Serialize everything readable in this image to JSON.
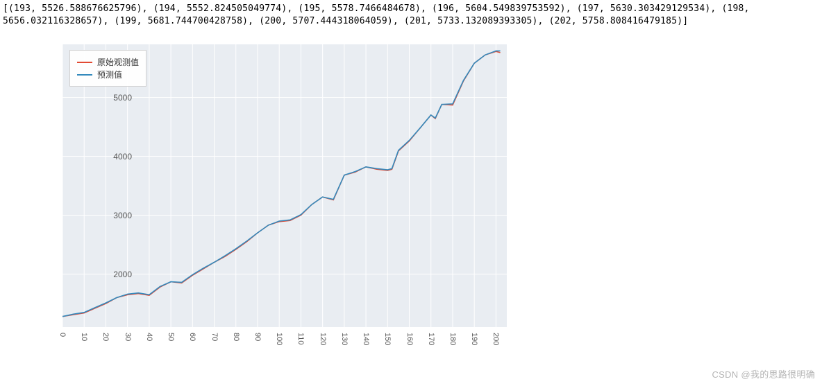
{
  "header_text": "[(193, 5526.588676625796), (194, 5552.824505049774), (195, 5578.7466484678), (196, 5604.549839753592), (197, 5630.303429129534), (198, 5656.032116328657), (199, 5681.744700428758), (200, 5707.444318064059), (201, 5733.132089393305), (202, 5758.808416479185)]",
  "watermark": "CSDN @我的思路很明确",
  "chart_data": {
    "type": "line",
    "title": "",
    "xlabel": "",
    "ylabel": "",
    "xlim": [
      0,
      205
    ],
    "ylim": [
      1100,
      5900
    ],
    "x_ticks": [
      0,
      10,
      20,
      30,
      40,
      50,
      60,
      70,
      80,
      90,
      100,
      110,
      120,
      130,
      140,
      150,
      160,
      170,
      180,
      190,
      200
    ],
    "y_ticks": [
      2000,
      3000,
      4000,
      5000
    ],
    "legend_position": "upper left",
    "grid": true,
    "series": [
      {
        "name": "原始观测值",
        "color": "#e24a33",
        "x": [
          0,
          5,
          10,
          15,
          20,
          25,
          30,
          35,
          40,
          45,
          50,
          55,
          60,
          65,
          70,
          75,
          80,
          85,
          90,
          95,
          100,
          105,
          110,
          115,
          120,
          125,
          130,
          135,
          140,
          145,
          150,
          152,
          155,
          160,
          165,
          170,
          172,
          175,
          180,
          185,
          190,
          195,
          200,
          202
        ],
        "values": [
          1280,
          1310,
          1340,
          1420,
          1500,
          1600,
          1650,
          1670,
          1640,
          1780,
          1870,
          1850,
          1980,
          2090,
          2200,
          2300,
          2420,
          2550,
          2700,
          2830,
          2890,
          2910,
          3000,
          3180,
          3310,
          3260,
          3680,
          3730,
          3820,
          3780,
          3760,
          3780,
          4090,
          4260,
          4480,
          4700,
          4640,
          4880,
          4870,
          5280,
          5580,
          5720,
          5780,
          5760
        ]
      },
      {
        "name": "预测值",
        "color": "#348abd",
        "x": [
          0,
          5,
          10,
          15,
          20,
          25,
          30,
          35,
          40,
          45,
          50,
          55,
          60,
          65,
          70,
          75,
          80,
          85,
          90,
          95,
          100,
          105,
          110,
          115,
          120,
          125,
          130,
          135,
          140,
          145,
          150,
          152,
          155,
          160,
          165,
          170,
          172,
          175,
          180,
          185,
          190,
          195,
          200,
          202
        ],
        "values": [
          1280,
          1320,
          1350,
          1430,
          1510,
          1600,
          1660,
          1680,
          1650,
          1790,
          1870,
          1860,
          1990,
          2100,
          2200,
          2310,
          2430,
          2560,
          2700,
          2830,
          2900,
          2920,
          3010,
          3180,
          3310,
          3270,
          3680,
          3740,
          3820,
          3790,
          3770,
          3790,
          4100,
          4270,
          4480,
          4700,
          4650,
          4880,
          4890,
          5290,
          5580,
          5720,
          5790,
          5790
        ]
      }
    ]
  }
}
